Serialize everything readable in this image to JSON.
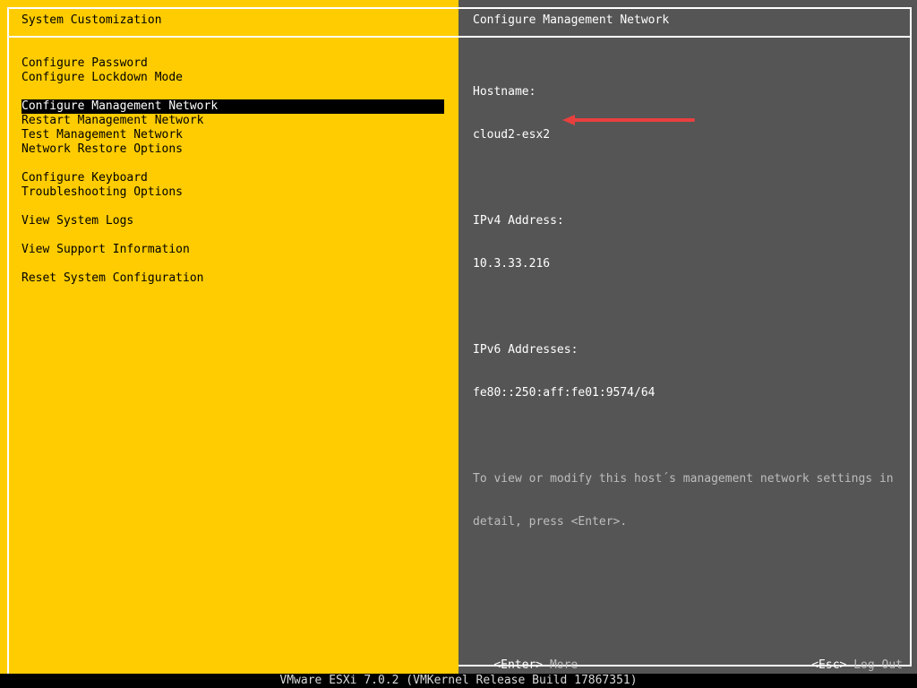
{
  "left_panel": {
    "title": "System Customization",
    "menu_groups": [
      [
        {
          "label": "Configure Password",
          "selected": false
        },
        {
          "label": "Configure Lockdown Mode",
          "selected": false
        }
      ],
      [
        {
          "label": "Configure Management Network",
          "selected": true
        },
        {
          "label": "Restart Management Network",
          "selected": false
        },
        {
          "label": "Test Management Network",
          "selected": false
        },
        {
          "label": "Network Restore Options",
          "selected": false
        }
      ],
      [
        {
          "label": "Configure Keyboard",
          "selected": false
        },
        {
          "label": "Troubleshooting Options",
          "selected": false
        }
      ],
      [
        {
          "label": "View System Logs",
          "selected": false
        }
      ],
      [
        {
          "label": "View Support Information",
          "selected": false
        }
      ],
      [
        {
          "label": "Reset System Configuration",
          "selected": false
        }
      ]
    ]
  },
  "right_panel": {
    "title": "Configure Management Network",
    "hostname_label": "Hostname:",
    "hostname_value": "cloud2-esx2",
    "ipv4_label": "IPv4 Address:",
    "ipv4_value": "10.3.33.216",
    "ipv6_label": "IPv6 Addresses:",
    "ipv6_value": "fe80::250:aff:fe01:9574/64",
    "hint_line1": "To view or modify this host´s management network settings in",
    "hint_line2": "detail, press <Enter>."
  },
  "footer": {
    "enter_key": "<Enter>",
    "enter_action": "More",
    "esc_key": "<Esc>",
    "esc_action": "Log Out"
  },
  "status_bar": "VMware ESXi 7.0.2 (VMKernel Release Build 17867351)",
  "annotation": {
    "arrow_color": "#e8403f"
  }
}
